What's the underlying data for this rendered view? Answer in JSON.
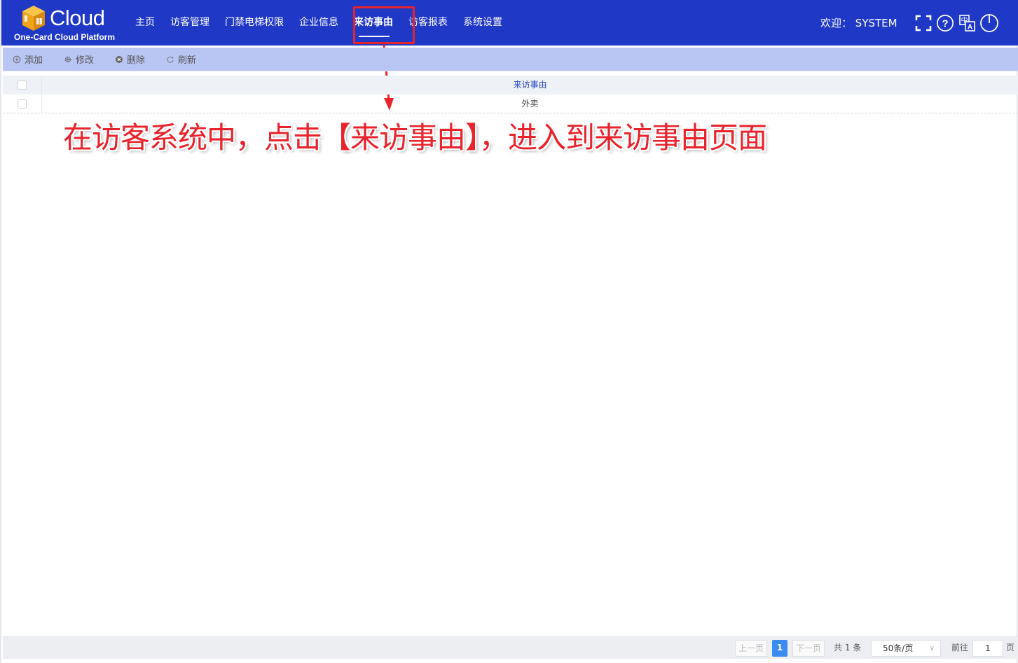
{
  "brand": {
    "name": "Cloud",
    "subtitle": "One-Card Cloud Platform",
    "colors": {
      "topbar": "#2038c6",
      "logo_orange": "#f2a51a"
    }
  },
  "nav": {
    "items": [
      {
        "label": "主页"
      },
      {
        "label": "访客管理"
      },
      {
        "label": "门禁电梯权限"
      },
      {
        "label": "企业信息"
      },
      {
        "label": "来访事由",
        "active": true
      },
      {
        "label": "访客报表"
      },
      {
        "label": "系统设置"
      }
    ]
  },
  "header": {
    "welcome_label": "欢迎：",
    "username": "SYSTEM",
    "icons": [
      "fullscreen-icon",
      "help-icon",
      "translate-icon",
      "power-icon"
    ]
  },
  "toolbar": {
    "buttons": [
      {
        "label": "添加",
        "icon": "add-icon"
      },
      {
        "label": "修改",
        "icon": "gear-icon"
      },
      {
        "label": "删除",
        "icon": "delete-icon"
      },
      {
        "label": "刷新",
        "icon": "refresh-icon"
      }
    ]
  },
  "table": {
    "columns": [
      "来访事由"
    ],
    "rows": [
      [
        "外卖"
      ]
    ]
  },
  "annotation": {
    "text": "在访客系统中，点击【来访事由】，进入到来访事由页面",
    "color": "#e8232b"
  },
  "pager": {
    "prev": "上一页",
    "current": "1",
    "next": "下一页",
    "total": "共 1 条",
    "page_size": "50条/页",
    "goto_label": "前往",
    "goto_value": "1",
    "page_suffix": "页"
  }
}
